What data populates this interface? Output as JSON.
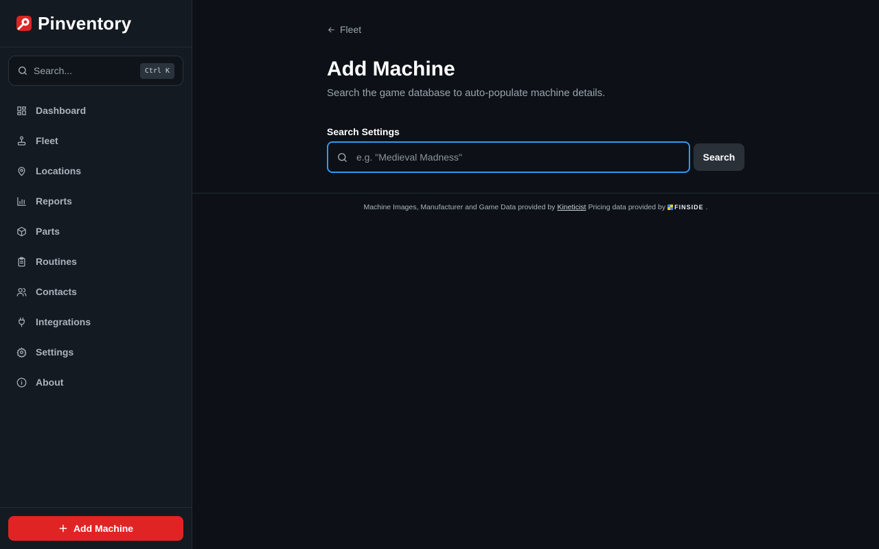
{
  "brand": {
    "name": "Pinventory",
    "accent": "#e02424"
  },
  "search": {
    "placeholder": "Search...",
    "shortcut": "Ctrl K"
  },
  "nav": {
    "items": [
      {
        "label": "Dashboard",
        "icon": "dashboard-icon"
      },
      {
        "label": "Fleet",
        "icon": "joystick-icon"
      },
      {
        "label": "Locations",
        "icon": "map-pin-icon"
      },
      {
        "label": "Reports",
        "icon": "bar-chart-icon"
      },
      {
        "label": "Parts",
        "icon": "package-icon"
      },
      {
        "label": "Routines",
        "icon": "clipboard-list-icon"
      },
      {
        "label": "Contacts",
        "icon": "users-icon"
      },
      {
        "label": "Integrations",
        "icon": "plug-icon"
      },
      {
        "label": "Settings",
        "icon": "gear-icon"
      },
      {
        "label": "About",
        "icon": "info-icon"
      }
    ]
  },
  "sidebar_footer": {
    "add_label": "Add Machine"
  },
  "main": {
    "back_label": "Fleet",
    "title": "Add Machine",
    "subtitle": "Search the game database to auto-populate machine details.",
    "field_label": "Search Settings",
    "field_placeholder": "e.g. \"Medieval Madness\"",
    "field_value": "",
    "search_button": "Search"
  },
  "attribution": {
    "prefix": "Machine Images, Manufacturer and Game Data provided by",
    "link_1": "Kineticist",
    "middle": "Pricing data provided by",
    "link_2": "FINSIDE",
    "suffix": "."
  },
  "colors": {
    "background": "#0d1117",
    "sidebar": "#141a21",
    "focus_ring": "#2f9bef",
    "primary_button": "#e02424"
  }
}
